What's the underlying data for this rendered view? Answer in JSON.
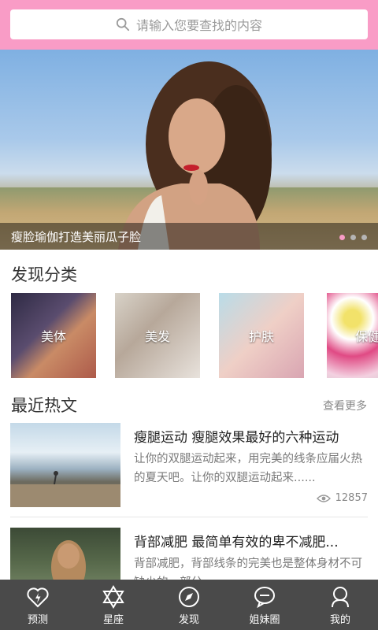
{
  "search": {
    "placeholder": "请输入您要查找的内容",
    "icon": "search-icon"
  },
  "banner": {
    "caption": "瘦脸瑜伽打造美丽瓜子脸",
    "dots": 3,
    "active_dot": 1
  },
  "categories": {
    "title": "发现分类",
    "items": [
      {
        "label": "美体"
      },
      {
        "label": "美发"
      },
      {
        "label": "护肤"
      },
      {
        "label": "保健"
      }
    ]
  },
  "articles": {
    "title": "最近热文",
    "more_label": "查看更多",
    "items": [
      {
        "title": "瘦腿运动  瘦腿效果最好的六种运动",
        "desc": "让你的双腿运动起来，用完美的线条应届火热的夏天吧。让你的双腿运动起来......",
        "views": "12857"
      },
      {
        "title": "背部减肥  最简单有效的卑不减肥...",
        "desc": "背部减肥，背部线条的完美也是整体身材不可缺少的一部分。"
      }
    ]
  },
  "nav": {
    "items": [
      {
        "label": "预测",
        "icon": "heart-bolt-icon"
      },
      {
        "label": "星座",
        "icon": "star-of-david-icon"
      },
      {
        "label": "发现",
        "icon": "compass-icon"
      },
      {
        "label": "姐妹圈",
        "icon": "chat-bubble-icon"
      },
      {
        "label": "我的",
        "icon": "user-icon"
      }
    ]
  },
  "colors": {
    "accent": "#f99cc6",
    "nav_bg": "#4a4a4a"
  }
}
